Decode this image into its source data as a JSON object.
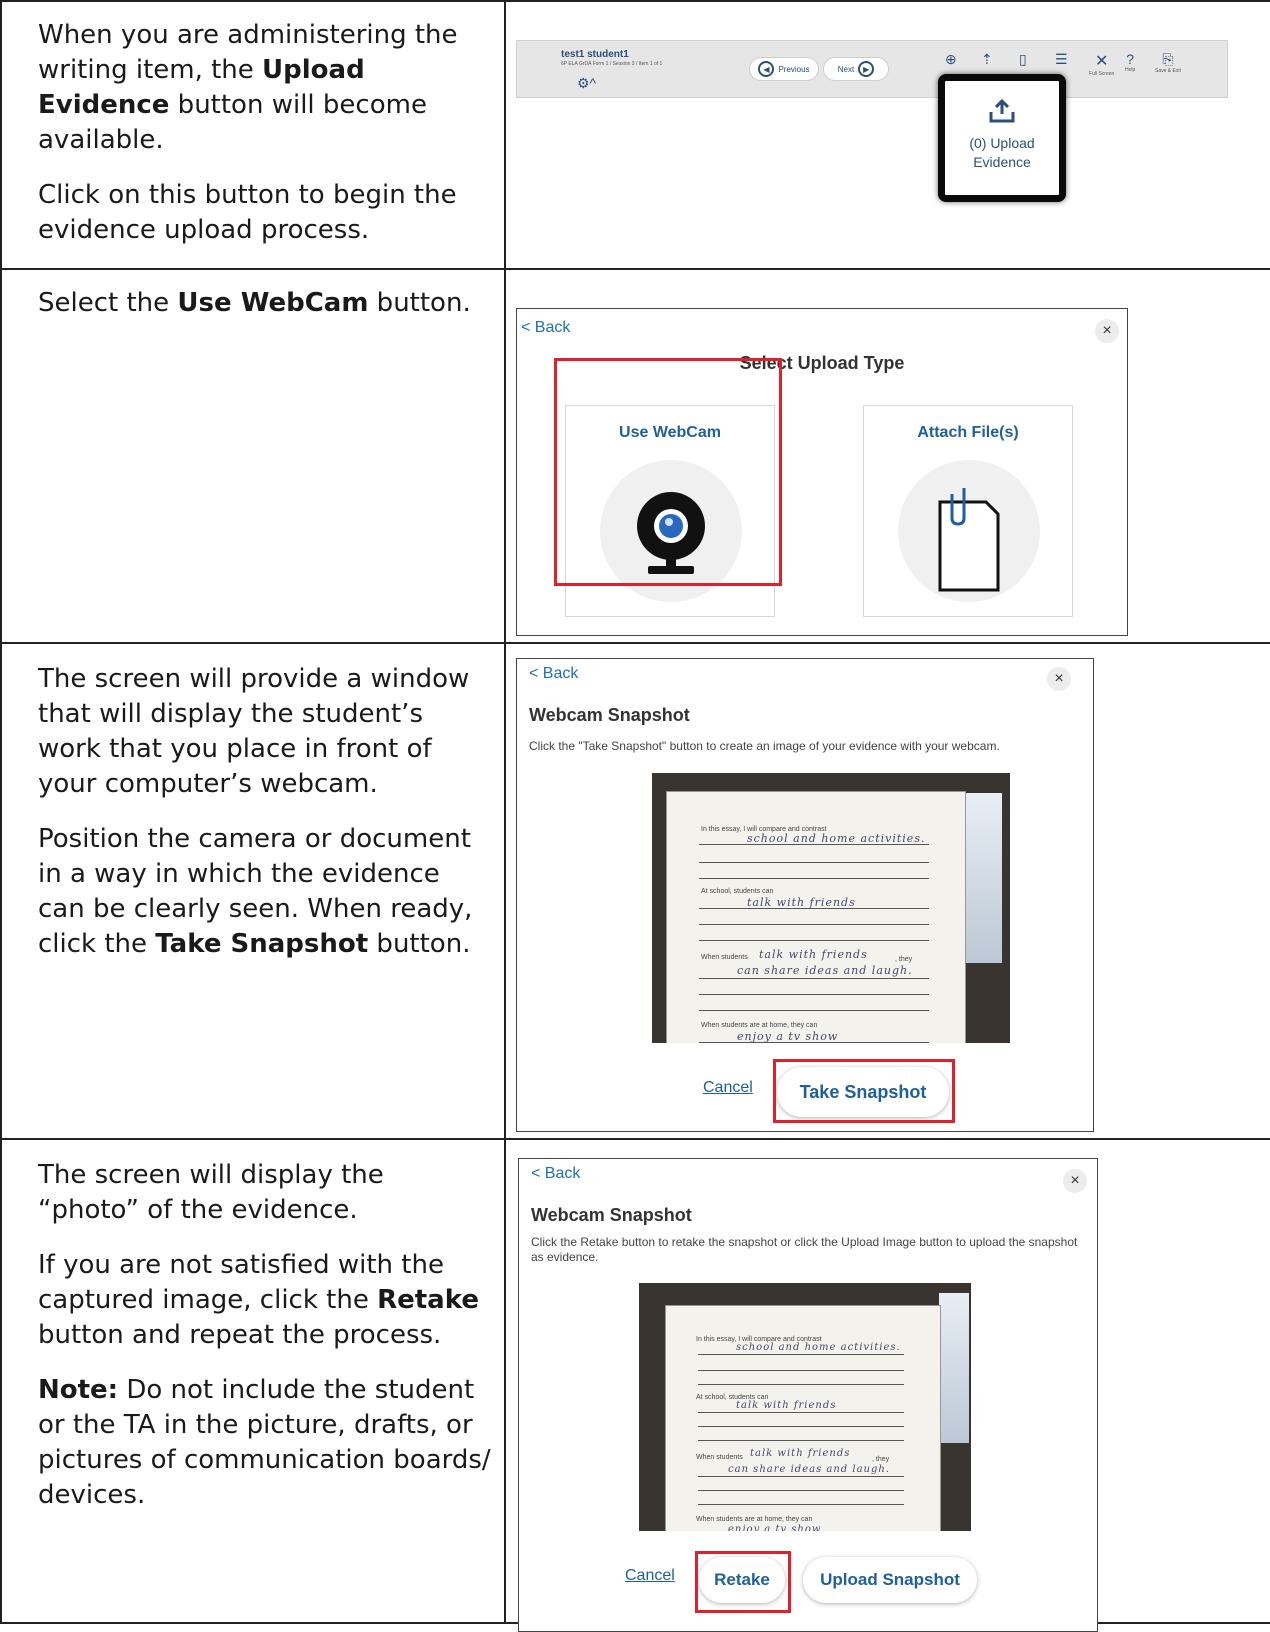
{
  "steps": {
    "row1": {
      "p1_pre": "When you are administering the writing item, the ",
      "p1_bold": "Upload Evidence",
      "p1_post": " button will become available.",
      "p2": "Click on this button to begin the evidence upload process."
    },
    "row2": {
      "p1_pre": "Select the ",
      "p1_bold": "Use WebCam",
      "p1_post": " button."
    },
    "row3": {
      "p1": "The screen will provide a window that will display the student’s work that you place in front of your computer’s webcam.",
      "p2_pre": "Position the camera or document in a way in which the evidence can be clearly seen. When ready, click the ",
      "p2_bold": "Take Snapshot",
      "p2_post": " button."
    },
    "row4": {
      "p1": "The screen will display the “photo” of the evidence.",
      "p2_pre": "If you are not satisfied with the captured image, click the ",
      "p2_bold": "Retake",
      "p2_post": " button and repeat the process.",
      "p3_bold": "Note:",
      "p3_post": " Do not include the student or the TA in the picture, drafts, or pictures of communication boards/ devices."
    }
  },
  "toolbar": {
    "student": "test1 student1",
    "session": "6P ELA GrDA Form 1 / Session 3 / Item 1 of 1",
    "previous": "Previous",
    "next": "Next",
    "full_screen": "Full Screen",
    "help_short": "Help",
    "save_exit": "Save & Exit",
    "upload_label": "(0) Upload Evidence",
    "help_glyph": "?"
  },
  "select_dialog": {
    "back": "< Back",
    "close": "×",
    "title": "Select Upload Type",
    "webcam": "Use WebCam",
    "attach": "Attach File(s)"
  },
  "snapshot_dialog": {
    "back": "< Back",
    "close": "×",
    "title": "Webcam Snapshot",
    "desc": "Click the \"Take Snapshot\" button to create an image of your evidence with your webcam.",
    "cancel": "Cancel",
    "take": "Take Snapshot"
  },
  "retake_dialog": {
    "back": "< Back",
    "close": "×",
    "title": "Webcam Snapshot",
    "desc": "Click the Retake button to retake the snapshot or click the Upload Image button to upload the snapshot as evidence.",
    "cancel": "Cancel",
    "retake": "Retake",
    "upload": "Upload Snapshot"
  },
  "worksheet": {
    "prompt1": "In this essay, I will compare and contrast",
    "answer1": "school and home activities.",
    "prompt2": "At school, students can",
    "answer2": "talk with friends",
    "prompt3a": "When students",
    "answer3a": "talk with friends",
    "prompt3b": ", they",
    "answer3b": "can share ideas and laugh.",
    "prompt4": "When students are at home, they can",
    "answer4": "enjoy a tv show"
  }
}
